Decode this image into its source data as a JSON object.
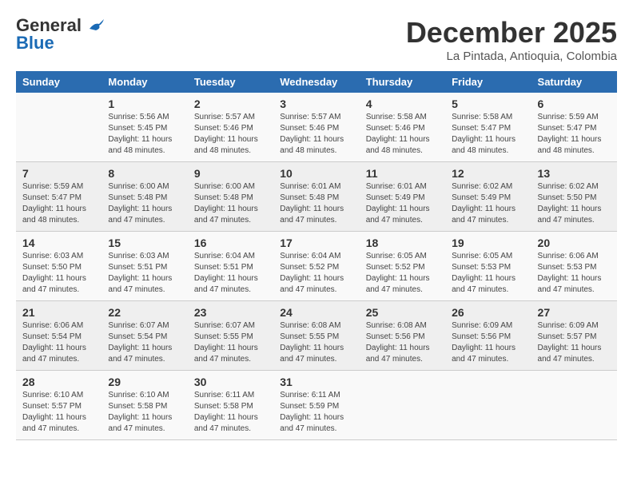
{
  "logo": {
    "line1": "General",
    "line2": "Blue"
  },
  "title": "December 2025",
  "subtitle": "La Pintada, Antioquia, Colombia",
  "days_of_week": [
    "Sunday",
    "Monday",
    "Tuesday",
    "Wednesday",
    "Thursday",
    "Friday",
    "Saturday"
  ],
  "weeks": [
    [
      {
        "day": "",
        "info": ""
      },
      {
        "day": "1",
        "info": "Sunrise: 5:56 AM\nSunset: 5:45 PM\nDaylight: 11 hours and 48 minutes."
      },
      {
        "day": "2",
        "info": "Sunrise: 5:57 AM\nSunset: 5:46 PM\nDaylight: 11 hours and 48 minutes."
      },
      {
        "day": "3",
        "info": "Sunrise: 5:57 AM\nSunset: 5:46 PM\nDaylight: 11 hours and 48 minutes."
      },
      {
        "day": "4",
        "info": "Sunrise: 5:58 AM\nSunset: 5:46 PM\nDaylight: 11 hours and 48 minutes."
      },
      {
        "day": "5",
        "info": "Sunrise: 5:58 AM\nSunset: 5:47 PM\nDaylight: 11 hours and 48 minutes."
      },
      {
        "day": "6",
        "info": "Sunrise: 5:59 AM\nSunset: 5:47 PM\nDaylight: 11 hours and 48 minutes."
      }
    ],
    [
      {
        "day": "7",
        "info": "Sunrise: 5:59 AM\nSunset: 5:47 PM\nDaylight: 11 hours and 48 minutes."
      },
      {
        "day": "8",
        "info": "Sunrise: 6:00 AM\nSunset: 5:48 PM\nDaylight: 11 hours and 47 minutes."
      },
      {
        "day": "9",
        "info": "Sunrise: 6:00 AM\nSunset: 5:48 PM\nDaylight: 11 hours and 47 minutes."
      },
      {
        "day": "10",
        "info": "Sunrise: 6:01 AM\nSunset: 5:48 PM\nDaylight: 11 hours and 47 minutes."
      },
      {
        "day": "11",
        "info": "Sunrise: 6:01 AM\nSunset: 5:49 PM\nDaylight: 11 hours and 47 minutes."
      },
      {
        "day": "12",
        "info": "Sunrise: 6:02 AM\nSunset: 5:49 PM\nDaylight: 11 hours and 47 minutes."
      },
      {
        "day": "13",
        "info": "Sunrise: 6:02 AM\nSunset: 5:50 PM\nDaylight: 11 hours and 47 minutes."
      }
    ],
    [
      {
        "day": "14",
        "info": "Sunrise: 6:03 AM\nSunset: 5:50 PM\nDaylight: 11 hours and 47 minutes."
      },
      {
        "day": "15",
        "info": "Sunrise: 6:03 AM\nSunset: 5:51 PM\nDaylight: 11 hours and 47 minutes."
      },
      {
        "day": "16",
        "info": "Sunrise: 6:04 AM\nSunset: 5:51 PM\nDaylight: 11 hours and 47 minutes."
      },
      {
        "day": "17",
        "info": "Sunrise: 6:04 AM\nSunset: 5:52 PM\nDaylight: 11 hours and 47 minutes."
      },
      {
        "day": "18",
        "info": "Sunrise: 6:05 AM\nSunset: 5:52 PM\nDaylight: 11 hours and 47 minutes."
      },
      {
        "day": "19",
        "info": "Sunrise: 6:05 AM\nSunset: 5:53 PM\nDaylight: 11 hours and 47 minutes."
      },
      {
        "day": "20",
        "info": "Sunrise: 6:06 AM\nSunset: 5:53 PM\nDaylight: 11 hours and 47 minutes."
      }
    ],
    [
      {
        "day": "21",
        "info": "Sunrise: 6:06 AM\nSunset: 5:54 PM\nDaylight: 11 hours and 47 minutes."
      },
      {
        "day": "22",
        "info": "Sunrise: 6:07 AM\nSunset: 5:54 PM\nDaylight: 11 hours and 47 minutes."
      },
      {
        "day": "23",
        "info": "Sunrise: 6:07 AM\nSunset: 5:55 PM\nDaylight: 11 hours and 47 minutes."
      },
      {
        "day": "24",
        "info": "Sunrise: 6:08 AM\nSunset: 5:55 PM\nDaylight: 11 hours and 47 minutes."
      },
      {
        "day": "25",
        "info": "Sunrise: 6:08 AM\nSunset: 5:56 PM\nDaylight: 11 hours and 47 minutes."
      },
      {
        "day": "26",
        "info": "Sunrise: 6:09 AM\nSunset: 5:56 PM\nDaylight: 11 hours and 47 minutes."
      },
      {
        "day": "27",
        "info": "Sunrise: 6:09 AM\nSunset: 5:57 PM\nDaylight: 11 hours and 47 minutes."
      }
    ],
    [
      {
        "day": "28",
        "info": "Sunrise: 6:10 AM\nSunset: 5:57 PM\nDaylight: 11 hours and 47 minutes."
      },
      {
        "day": "29",
        "info": "Sunrise: 6:10 AM\nSunset: 5:58 PM\nDaylight: 11 hours and 47 minutes."
      },
      {
        "day": "30",
        "info": "Sunrise: 6:11 AM\nSunset: 5:58 PM\nDaylight: 11 hours and 47 minutes."
      },
      {
        "day": "31",
        "info": "Sunrise: 6:11 AM\nSunset: 5:59 PM\nDaylight: 11 hours and 47 minutes."
      },
      {
        "day": "",
        "info": ""
      },
      {
        "day": "",
        "info": ""
      },
      {
        "day": "",
        "info": ""
      }
    ]
  ]
}
